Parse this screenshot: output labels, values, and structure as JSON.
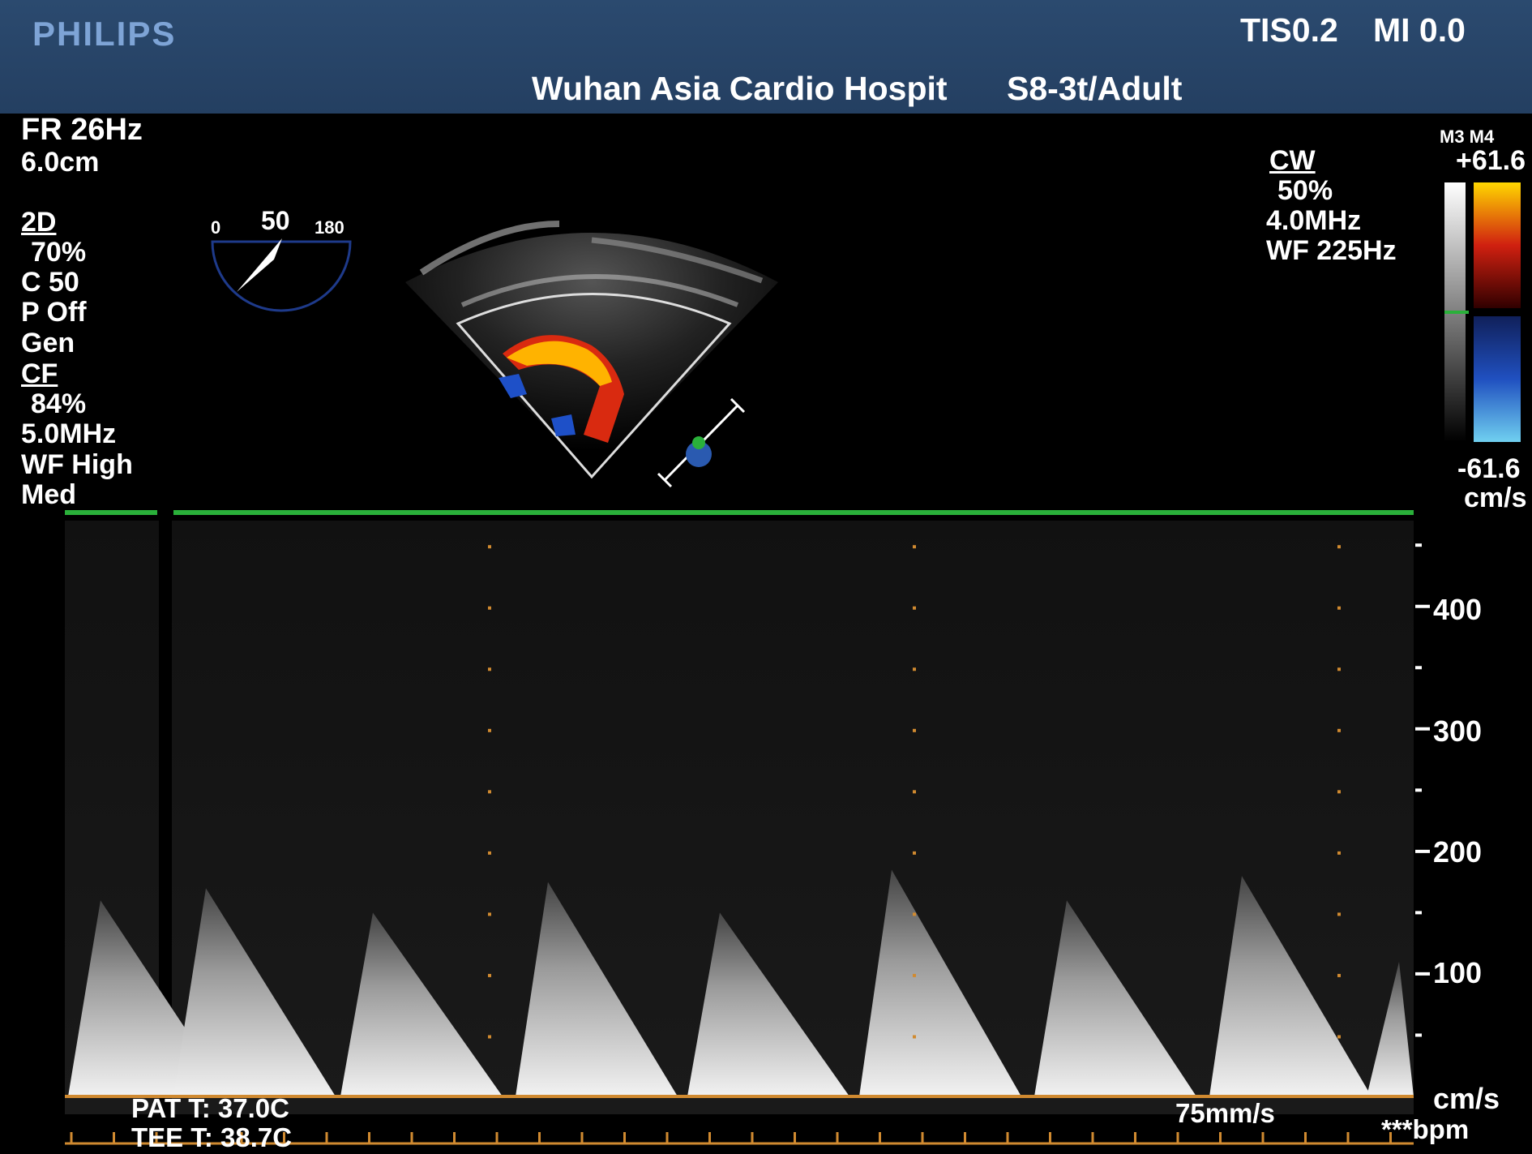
{
  "header": {
    "brand": "PHILIPS",
    "tis": "TIS0.2",
    "mi": "MI 0.0",
    "facility": "Wuhan Asia Cardio Hospit",
    "probe": "S8-3t/Adult"
  },
  "left_panel": {
    "frame_rate": "FR 26Hz",
    "depth": "6.0cm",
    "mode_2d": "2D",
    "gain_2d": "70%",
    "compression": "C 50",
    "persistence": "P Off",
    "optimization": "Gen",
    "mode_cf": "CF",
    "gain_cf": "84%",
    "freq_cf": "5.0MHz",
    "wall_filter": "WF High",
    "flow_setting": "Med"
  },
  "angle_indicator": {
    "min": "0",
    "value": "50",
    "max": "180"
  },
  "doppler_panel": {
    "mode": "CW",
    "gain": "50%",
    "freq": "4.0MHz",
    "wall_filter": "WF 225Hz"
  },
  "color_scale": {
    "map_labels": "M3 M4",
    "top": "+61.6",
    "bottom": "-61.6",
    "unit": "cm/s",
    "colors": {
      "top": "#ffd700",
      "mid_pos": "#a01010",
      "mid_neg": "#1a3a9a",
      "bottom": "#6ad0f0"
    }
  },
  "spectrum": {
    "scale": {
      "ticks": [
        "400",
        "300",
        "200",
        "100"
      ],
      "unit": "cm/s",
      "max": 470
    },
    "sweep_speed": "75mm/s",
    "heart_rate": "***bpm",
    "patient_temp": "PAT T: 37.0C",
    "tee_temp": "TEE T: 38.7C",
    "baseline_color": "#d08a30",
    "trace_color": "#2ab03a"
  }
}
